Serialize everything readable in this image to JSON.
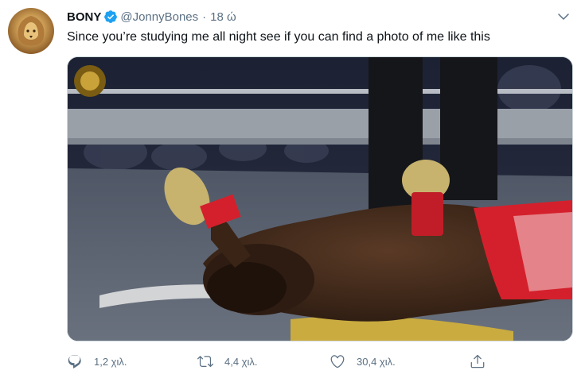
{
  "tweet": {
    "author_name": "BONY",
    "handle": "@JonnyBones",
    "separator": "·",
    "time": "18 ώ",
    "text": "Since you’re studying me all night see if you can find a photo of me like this"
  },
  "actions": {
    "replies": "1,2 χιλ.",
    "retweets": "4,4 χιλ.",
    "likes": "30,4 χιλ."
  },
  "icons": {
    "avatar": "lion-avatar",
    "verified": "verified-badge-icon",
    "more": "chevron-down-icon",
    "reply": "reply-icon",
    "retweet": "retweet-icon",
    "like": "heart-icon",
    "share": "share-icon"
  },
  "colors": {
    "verified": "#1da1f2",
    "secondary_text": "#5b7083",
    "primary_text": "#0f1419",
    "border": "#cfd9de",
    "trunks": "#d4202c"
  }
}
